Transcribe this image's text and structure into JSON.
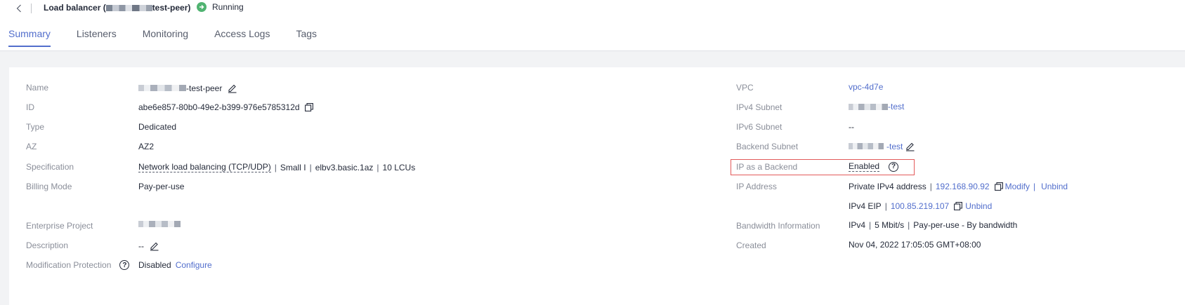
{
  "header": {
    "title_prefix": "Load balancer (",
    "title_suffix": "test-peer)",
    "status": "Running",
    "status_color": "#50b371"
  },
  "tabs": [
    "Summary",
    "Listeners",
    "Monitoring",
    "Access Logs",
    "Tags"
  ],
  "left": {
    "name": {
      "label": "Name",
      "value_suffix": "-test-peer"
    },
    "id": {
      "label": "ID",
      "value": "abe6e857-80b0-49e2-b399-976e5785312d"
    },
    "type": {
      "label": "Type",
      "value": "Dedicated"
    },
    "az": {
      "label": "AZ",
      "value": "AZ2"
    },
    "specification": {
      "label": "Specification",
      "link": "Network load balancing (TCP/UDP)",
      "size": "Small I",
      "flavor": "elbv3.basic.1az",
      "lcus": "10 LCUs"
    },
    "billing": {
      "label": "Billing Mode",
      "value": "Pay-per-use"
    },
    "enterprise_project": {
      "label": "Enterprise Project"
    },
    "description": {
      "label": "Description",
      "value": "--"
    },
    "modification_protection": {
      "label": "Modification Protection",
      "value": "Disabled",
      "action": "Configure"
    }
  },
  "right": {
    "vpc": {
      "label": "VPC",
      "value": "vpc-4d7e"
    },
    "ipv4_subnet": {
      "label": "IPv4 Subnet",
      "value_suffix": "-test"
    },
    "ipv6_subnet": {
      "label": "IPv6 Subnet",
      "value": "--"
    },
    "backend_subnet": {
      "label": "Backend Subnet",
      "value_suffix": "-test"
    },
    "ip_as_backend": {
      "label": "IP as a Backend",
      "value": "Enabled"
    },
    "ip_address": {
      "label": "IP Address",
      "private_label": "Private IPv4 address",
      "private_ip": "192.168.90.92",
      "modify": "Modify",
      "unbind": "Unbind",
      "eip_label": "IPv4 EIP",
      "eip": "100.85.219.107",
      "eip_unbind": "Unbind"
    },
    "bandwidth": {
      "label": "Bandwidth Information",
      "version": "IPv4",
      "speed": "5 Mbit/s",
      "billing": "Pay-per-use - By bandwidth"
    },
    "created": {
      "label": "Created",
      "value": "Nov 04, 2022 17:05:05 GMT+08:00"
    }
  },
  "colors": {
    "link": "#526ecc",
    "highlight_border": "#e35a5a"
  }
}
